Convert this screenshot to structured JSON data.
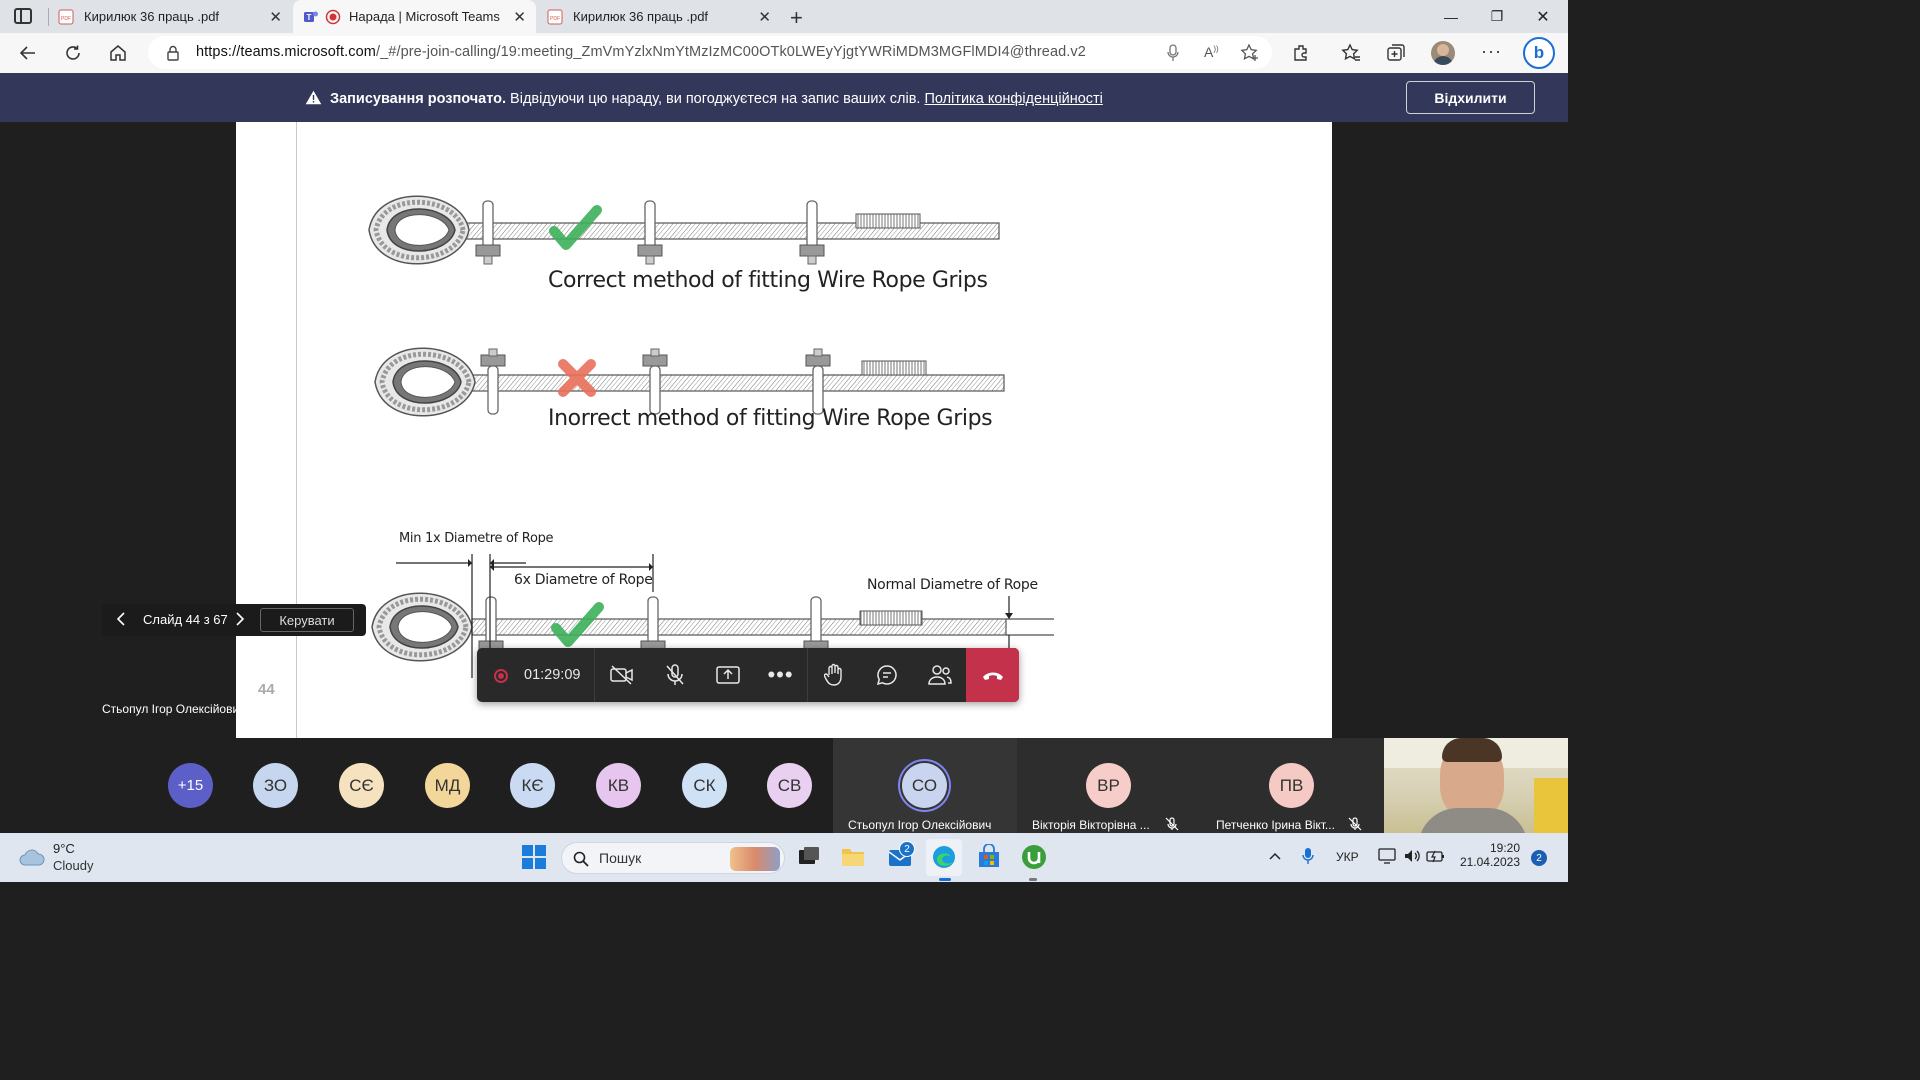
{
  "browser": {
    "tabs": [
      {
        "title": "Кирилюк 36 праць .pdf",
        "active": false,
        "icon": "pdf-icon"
      },
      {
        "title": "Нарада | Microsoft Teams",
        "active": true,
        "icon": "teams-icon"
      },
      {
        "title": "Кирилюк 36 праць .pdf",
        "active": false,
        "icon": "pdf-icon"
      }
    ],
    "url_host": "https://teams.microsoft.com",
    "url_rest": "/_#/pre-join-calling/19:meeting_ZmVmYzlxNmYtMzIzMC00OTk0LWEyYjgtYWRiMDM3MGFlMDI4@thread.v2"
  },
  "banner": {
    "bold": "Записування розпочато.",
    "text": "Відвідуючи цю нараду, ви погоджуєтеся на запис ваших слів.",
    "link": "Політика конфіденційності",
    "dismiss": "Відхилити",
    "color": "#33375a"
  },
  "slide": {
    "caption_correct": "Correct method of fitting Wire Rope Grips",
    "caption_incorrect": "Inorrect method of fitting Wire Rope Grips",
    "label_min": "Min 1x Diametre of Rope",
    "label_6x": "6x Diametre of Rope",
    "label_normal": "Normal Diametre of Rope",
    "page_number": "44"
  },
  "slide_control": {
    "label": "Слайд 44 з 67",
    "manage": "Керувати"
  },
  "presenter_name": "Стьопул Ігор Олексійович",
  "call_bar": {
    "timer": "01:29:09",
    "hangup_color": "#c4314b"
  },
  "participants": {
    "overflow": "+15",
    "avatars": [
      {
        "initials": "ЗО",
        "color": "#c5d6ee"
      },
      {
        "initials": "СЄ",
        "color": "#f7e2bf"
      },
      {
        "initials": "МД",
        "color": "#f3d69a"
      },
      {
        "initials": "КЄ",
        "color": "#c9daf2"
      },
      {
        "initials": "КВ",
        "color": "#e6c6ee"
      },
      {
        "initials": "СК",
        "color": "#cfe1f4"
      },
      {
        "initials": "СВ",
        "color": "#ead0f0"
      }
    ],
    "tiles": [
      {
        "initials": "СО",
        "name": "Стьопул Ігор Олексійович",
        "color": "#c9d5ee"
      },
      {
        "initials": "ВР",
        "name": "Вікторія Вікторівна ...",
        "color": "#f6cdc8"
      },
      {
        "initials": "ПВ",
        "name": "Петченко Ірина Вікт...",
        "color": "#f5c9c4"
      }
    ]
  },
  "taskbar": {
    "temperature": "9°C",
    "condition": "Cloudy",
    "search": "Пошук",
    "mail_badge": "2",
    "language": "УКР",
    "time": "19:20",
    "date": "21.04.2023",
    "notifications": "2"
  }
}
